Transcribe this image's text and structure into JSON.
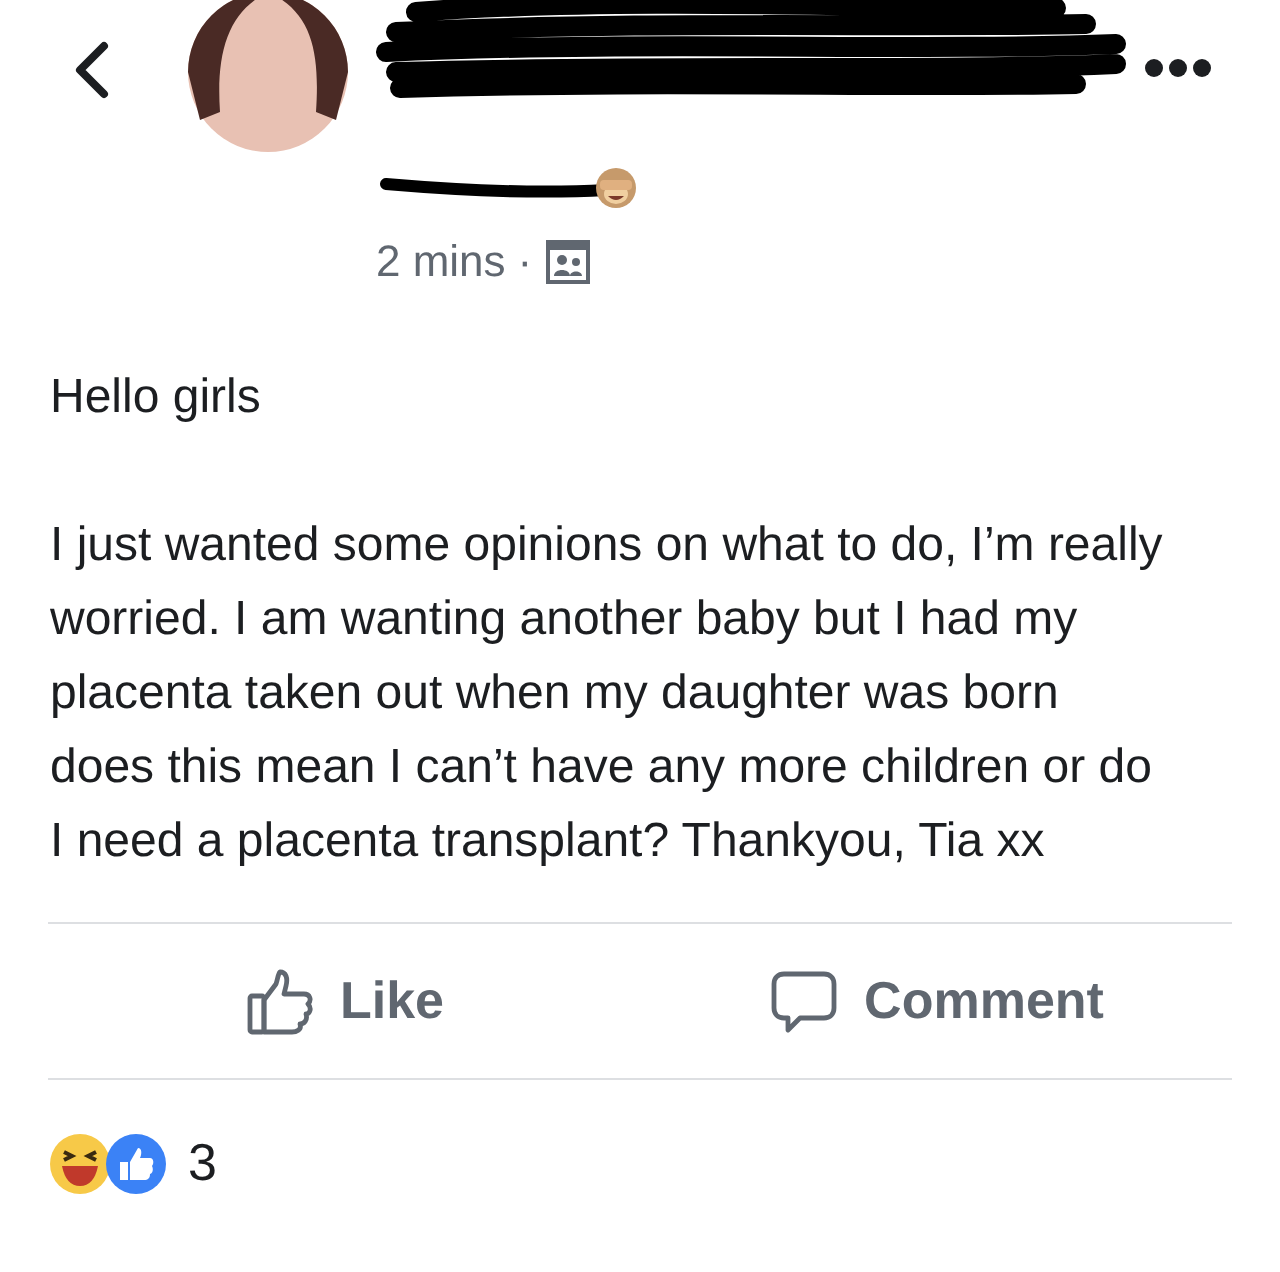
{
  "header": {
    "time": "2 mins",
    "separator": "·"
  },
  "post": {
    "paragraphs": [
      "Hello girls",
      "I just wanted some opinions on what to do, I’m really worried. I am wanting another baby but I had my placenta taken out when my daughter was born does this mean I can’t have any more children or do I need a placenta transplant? Thankyou, Tia xx"
    ]
  },
  "actions": [
    {
      "kind": "like",
      "label": "Like"
    },
    {
      "kind": "comment",
      "label": "Comment"
    }
  ],
  "reactions": {
    "count": "3"
  }
}
